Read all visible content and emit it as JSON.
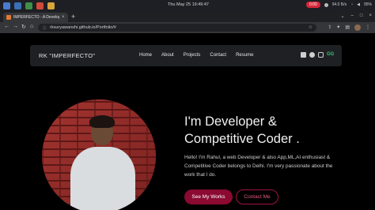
{
  "os": {
    "clock": "Thu May 25 19:49:47",
    "recording": "0:00",
    "network": "94.0 B/s",
    "battery": "95%"
  },
  "browser": {
    "tab_title": "IMPERFECTO - A Developer",
    "new_tab": "+",
    "url": "rksuryawanshi.github.io/Portfolio/#"
  },
  "nav": {
    "brand": "RK \"IMPERFECTO\"",
    "links": [
      "Home",
      "About",
      "Projects",
      "Contact",
      "Resume"
    ],
    "socials": [
      "linkedin-icon",
      "github-icon",
      "instagram-icon",
      "geeksforgeeks-icon"
    ]
  },
  "hero": {
    "headline_line1": "I'm Developer &",
    "headline_line2": "Competitive Coder .",
    "bio": "Hello! I'm Rahul, a web Developer & also App,ML,AI enthusiast & Competitive Coder belongs to Delhi. I'm very passionate about the work that I do.",
    "primary_btn": "See My Works",
    "secondary_btn": "Contact Me"
  },
  "colors": {
    "accent": "#8a0a31",
    "accent_outline": "#a0153f",
    "background": "#000000",
    "nav_bg": "#1f2024"
  }
}
